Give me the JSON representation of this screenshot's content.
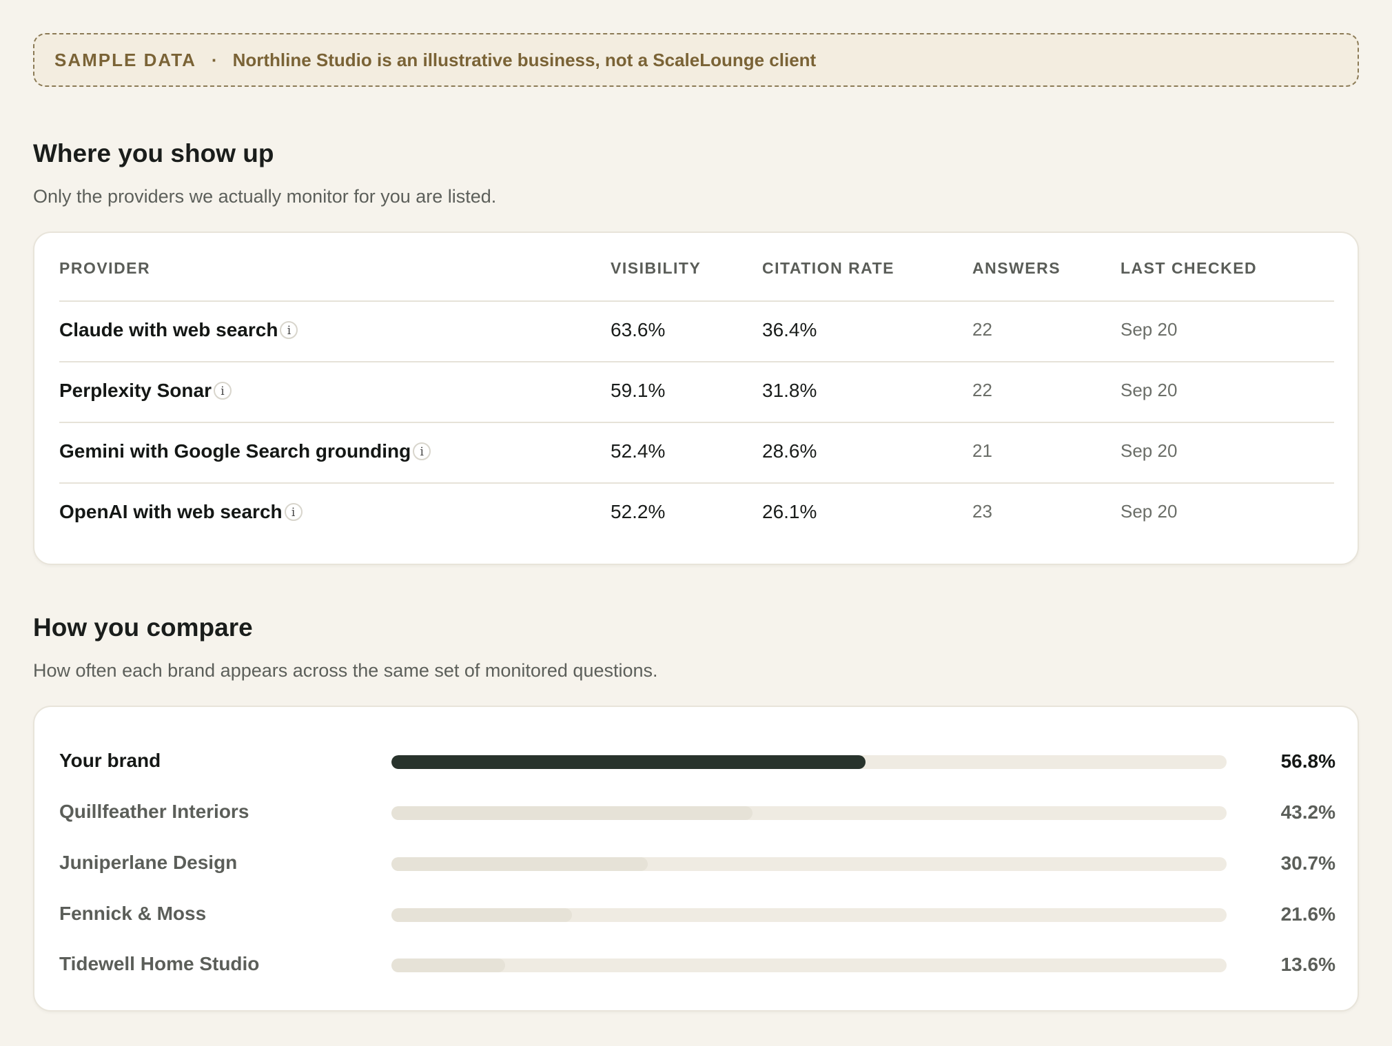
{
  "banner": {
    "tag": "SAMPLE DATA",
    "separator": "·",
    "note": "Northline Studio is an illustrative business, not a ScaleLounge client"
  },
  "providers_section": {
    "title": "Where you show up",
    "subtitle": "Only the providers we actually monitor for you are listed.",
    "columns": [
      "PROVIDER",
      "VISIBILITY",
      "CITATION RATE",
      "ANSWERS",
      "LAST CHECKED"
    ],
    "rows": [
      {
        "provider": "Claude with web search",
        "visibility": "63.6%",
        "citation_rate": "36.4%",
        "answers": "22",
        "last_checked": "Sep 20",
        "info_icon": "i"
      },
      {
        "provider": "Perplexity Sonar",
        "visibility": "59.1%",
        "citation_rate": "31.8%",
        "answers": "22",
        "last_checked": "Sep 20",
        "info_icon": "i"
      },
      {
        "provider": "Gemini with Google Search grounding",
        "visibility": "52.4%",
        "citation_rate": "28.6%",
        "answers": "21",
        "last_checked": "Sep 20",
        "info_icon": "i"
      },
      {
        "provider": "OpenAI with web search",
        "visibility": "52.2%",
        "citation_rate": "26.1%",
        "answers": "23",
        "last_checked": "Sep 20",
        "info_icon": "i"
      }
    ]
  },
  "compare_section": {
    "title": "How you compare",
    "subtitle": "How often each brand appears across the same set of monitored questions.",
    "brands": [
      {
        "name": "Your brand",
        "value": 56.8,
        "label": "56.8%",
        "highlight": true
      },
      {
        "name": "Quillfeather Interiors",
        "value": 43.2,
        "label": "43.2%",
        "highlight": false
      },
      {
        "name": "Juniperlane Design",
        "value": 30.7,
        "label": "30.7%",
        "highlight": false
      },
      {
        "name": "Fennick & Moss",
        "value": 21.6,
        "label": "21.6%",
        "highlight": false
      },
      {
        "name": "Tidewell Home Studio",
        "value": 13.6,
        "label": "13.6%",
        "highlight": false
      }
    ]
  },
  "colors": {
    "background": "#f6f3ec",
    "banner_text": "#7a6336",
    "your_brand_bar": "#28332c",
    "competitor_bar": "#e6e2d7",
    "bar_track": "#efebe2"
  }
}
